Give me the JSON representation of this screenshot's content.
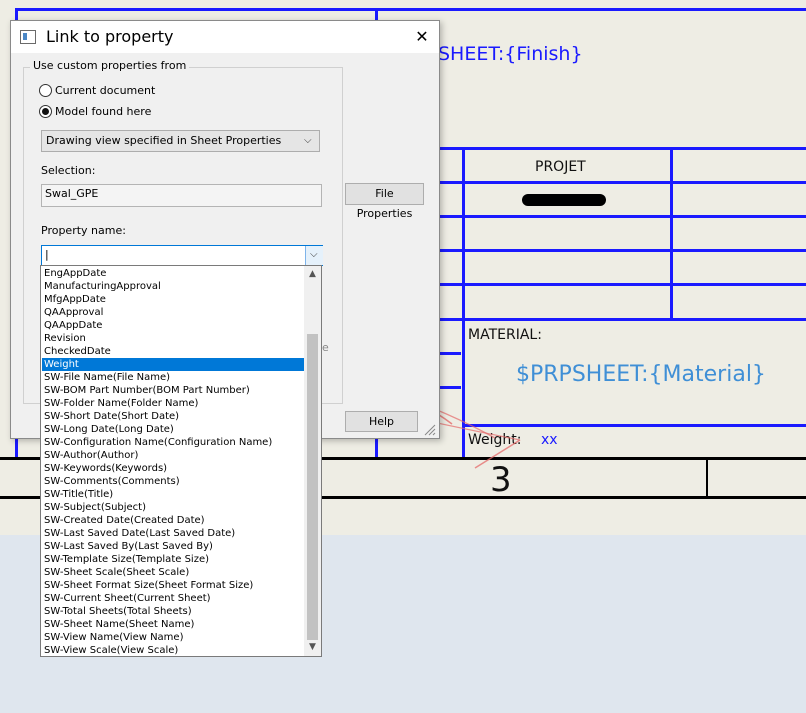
{
  "drawing": {
    "sheet_finish": "SHEET:{Finish}",
    "projet_label": "PROJET",
    "material_label": "MATERIAL:",
    "material_value": "$PRPSHEET:{Material}",
    "weight_label": "Weight:",
    "weight_value": "xx",
    "sheet_number": "3"
  },
  "dialog": {
    "title": "Link to property",
    "group_label": "Use custom properties from",
    "radio_current": "Current document",
    "radio_model": "Model found here",
    "view_select": "Drawing view specified in Sheet Properties",
    "selection_label": "Selection:",
    "selection_value": "Swal_GPE",
    "file_properties_button": "File Properties",
    "property_name_label": "Property name:",
    "property_name_value": "|",
    "help_button": "Help",
    "hidden_char": "e"
  },
  "property_list": [
    "EngAppDate",
    "ManufacturingApproval",
    "MfgAppDate",
    "QAApproval",
    "QAAppDate",
    "Revision",
    "CheckedDate",
    "Weight",
    "SW-File Name(File Name)",
    "SW-BOM Part Number(BOM Part Number)",
    "SW-Folder Name(Folder Name)",
    "SW-Short Date(Short Date)",
    "SW-Long Date(Long Date)",
    "SW-Configuration Name(Configuration Name)",
    "SW-Author(Author)",
    "SW-Keywords(Keywords)",
    "SW-Comments(Comments)",
    "SW-Title(Title)",
    "SW-Subject(Subject)",
    "SW-Created Date(Created Date)",
    "SW-Last Saved Date(Last Saved Date)",
    "SW-Last Saved By(Last Saved By)",
    "SW-Template Size(Template Size)",
    "SW-Sheet Scale(Sheet Scale)",
    "SW-Sheet Format Size(Sheet Format Size)",
    "SW-Current Sheet(Current Sheet)",
    "SW-Total Sheets(Total Sheets)",
    "SW-Sheet Name(Sheet Name)",
    "SW-View Name(View Name)",
    "SW-View Scale(View Scale)"
  ],
  "selected_property": "Weight",
  "colors": {
    "drawing_line": "#1a1aff",
    "accent_text": "#3f8fd6",
    "selection": "#0078d7",
    "annotation_arrow": "#e46a6a"
  }
}
